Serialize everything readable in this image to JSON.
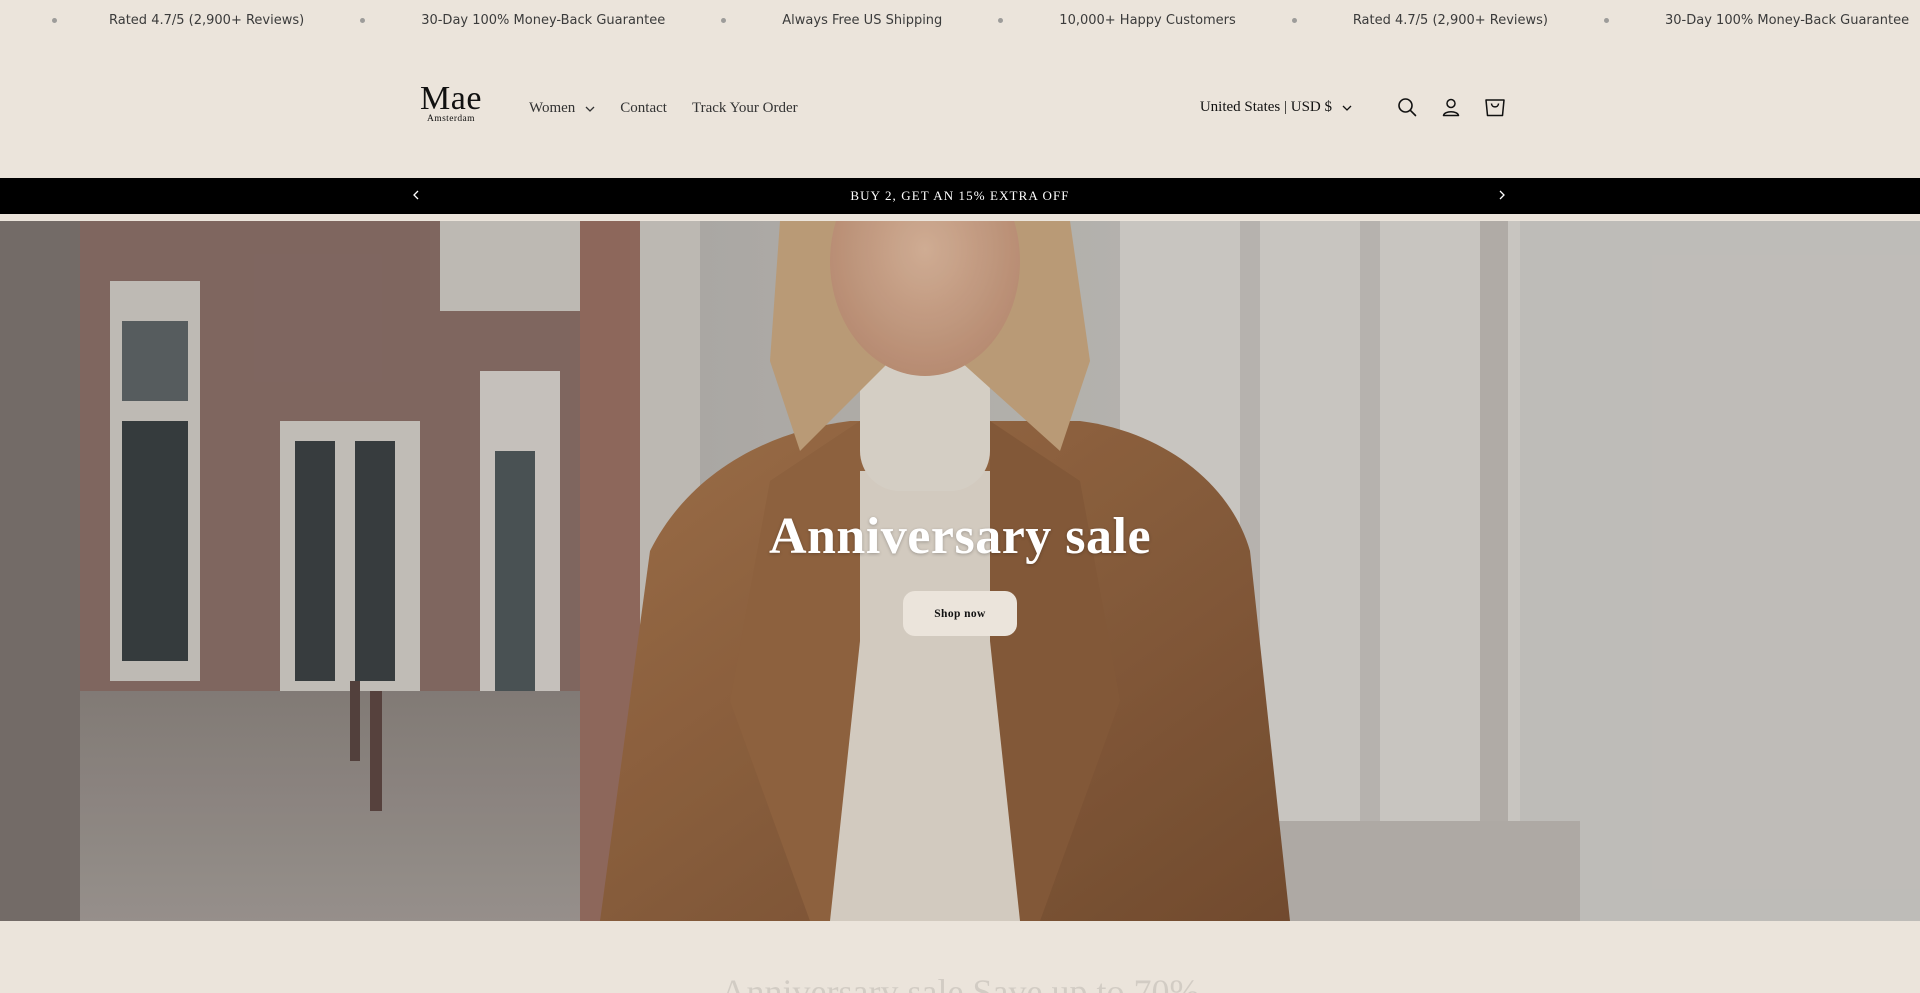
{
  "marquee": {
    "items": [
      "Rated 4.7/5 (2,900+ Reviews)",
      "30-Day 100% Money-Back Guarantee",
      "Always Free US Shipping",
      "10,000+ Happy Customers",
      "Rated 4.7/5 (2,900+ Reviews)",
      "30-Day 100% Money-Back Guarantee"
    ]
  },
  "header": {
    "logo": {
      "name": "Mae",
      "subtitle": "Amsterdam"
    },
    "nav": [
      {
        "label": "Women",
        "has_dropdown": true
      },
      {
        "label": "Contact",
        "has_dropdown": false
      },
      {
        "label": "Track Your Order",
        "has_dropdown": false
      }
    ],
    "locale": "United States | USD $",
    "icons": [
      "search-icon",
      "account-icon",
      "cart-icon"
    ]
  },
  "announcement": {
    "text": "BUY 2, GET AN 15% EXTRA OFF",
    "prev_icon": "chevron-left-icon",
    "next_icon": "chevron-right-icon"
  },
  "hero": {
    "title": "Anniversary sale",
    "button": "Shop now"
  },
  "next_section": {
    "heading": "Anniversary sale Save up to 70%"
  },
  "colors": {
    "background": "#ebe4db",
    "announcement_bg": "#000000",
    "button_bg": "#ebe4db",
    "text": "#1c1c1c"
  }
}
